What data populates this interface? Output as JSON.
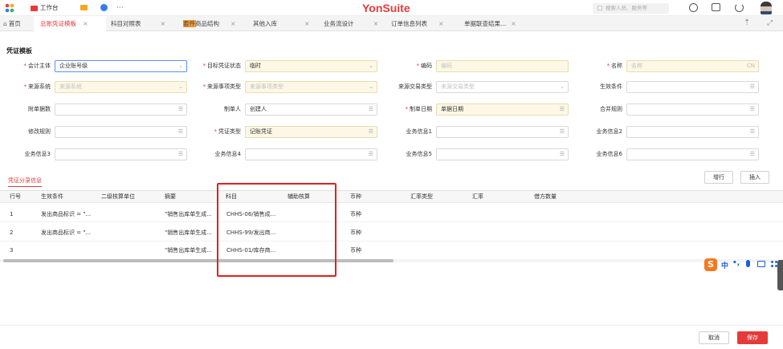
{
  "top": {
    "workbench": "工作台",
    "more": "···",
    "brand": "YonSuite",
    "search_placeholder": "搜索人员、服务等"
  },
  "tabs": [
    {
      "label": "首页"
    },
    {
      "label": "总账凭证模板"
    },
    {
      "label": "科目对照表"
    },
    {
      "label": "套件商品结构"
    },
    {
      "label": "其他入库"
    },
    {
      "label": "业务流设计"
    },
    {
      "label": "订单信息列表"
    },
    {
      "label": "单据联查结果..."
    }
  ],
  "page_title": "凭证模板",
  "form": {
    "accounting_entity": {
      "label": "会计主体",
      "value": "企业账号级"
    },
    "target_status": {
      "label": "目标凭证状态",
      "value": "临时"
    },
    "code": {
      "label": "编码",
      "placeholder": "编码"
    },
    "name": {
      "label": "名称",
      "placeholder": "名称",
      "suffix": "CN"
    },
    "source_system": {
      "label": "来源系统",
      "placeholder": "来源系统"
    },
    "source_event_type": {
      "label": "来源事项类型",
      "placeholder": "来源事项类型"
    },
    "source_transaction_type": {
      "label": "来源交易类型",
      "placeholder": "来源交易类型"
    },
    "effective_condition": {
      "label": "生效条件"
    },
    "attachment_count": {
      "label": "附单据数"
    },
    "creator": {
      "label": "制单人",
      "value": "创建人"
    },
    "creation_date": {
      "label": "制单日期",
      "value": "单据日期"
    },
    "merge_rule": {
      "label": "合并规则"
    },
    "modify_rule": {
      "label": "修改规则"
    },
    "voucher_type": {
      "label": "凭证类型",
      "value": "记账凭证"
    },
    "biz_info1": {
      "label": "业务信息1"
    },
    "biz_info2": {
      "label": "业务信息2"
    },
    "biz_info3": {
      "label": "业务信息3"
    },
    "biz_info4": {
      "label": "业务信息4"
    },
    "biz_info5": {
      "label": "业务信息5"
    },
    "biz_info6": {
      "label": "业务信息6"
    }
  },
  "entries": {
    "section_title": "凭证分录信息",
    "btn_add_row": "增行",
    "btn_insert": "插入",
    "columns": [
      "行号",
      "生效条件",
      "二级核算单位",
      "摘要",
      "科目",
      "辅助核算",
      "币种",
      "汇率类型",
      "汇率",
      "借方数量"
    ],
    "rows": [
      {
        "no": "1",
        "condition": "发出商品标识 = \"...",
        "summary": "\"销售出库单生成...",
        "account": "CHHS-06/销售成...",
        "currency": "币种"
      },
      {
        "no": "2",
        "condition": "发出商品标识 = \"...",
        "summary": "\"销售出库单生成...",
        "account": "CHHS-99/发出商...",
        "currency": "币种"
      },
      {
        "no": "3",
        "condition": "",
        "summary": "\"销售出库单生成...",
        "account": "CHHS-01/库存商...",
        "currency": "币种"
      }
    ]
  },
  "ime": {
    "zh": "中",
    "punct": "•,"
  },
  "footer": {
    "cancel": "取消",
    "save": "保存"
  },
  "colors": {
    "accent": "#e63a3a",
    "highlight_box": "#e02020",
    "required_field_bg": "#fdf8e6",
    "focus_border": "#5b8ff9"
  }
}
